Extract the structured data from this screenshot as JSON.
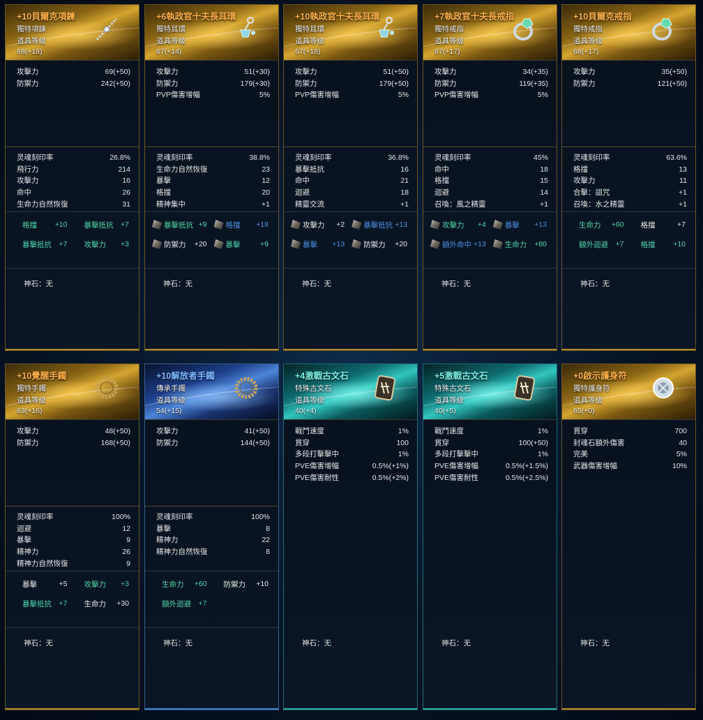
{
  "cards": [
    {
      "theme": "gold",
      "title": "+10貝爾克項鍊",
      "type": "獨特項鍊",
      "level_label": "道具等级",
      "level": "68(+18)",
      "icon": "necklace-icon",
      "main": [
        [
          "攻擊力",
          "69(+50)"
        ],
        [
          "防禦力",
          "242(+50)"
        ]
      ],
      "soul": [
        [
          "灵魂刻印率",
          "26.8%"
        ],
        [
          "飛行力",
          "214"
        ],
        [
          "攻擊力",
          "16"
        ],
        [
          "命中",
          "26"
        ],
        [
          "生命力自然恢復",
          "31"
        ]
      ],
      "bonus": [
        {
          "label": "格擋",
          "value": "+10",
          "color": "green",
          "icon": false
        },
        {
          "label": "暴擊抵抗",
          "value": "+7",
          "color": "green",
          "icon": false
        },
        {
          "label": "暴擊抵抗",
          "value": "+7",
          "color": "green",
          "icon": false
        },
        {
          "label": "攻擊力",
          "value": "+3",
          "color": "green",
          "icon": false
        }
      ],
      "godstone": "神石：无"
    },
    {
      "theme": "gold",
      "title": "+6執政官十夫長耳環",
      "type": "獨特耳環",
      "level_label": "道具等级",
      "level": "67(+14)",
      "icon": "earring-icon",
      "main": [
        [
          "攻擊力",
          "51(+30)"
        ],
        [
          "防禦力",
          "179(+30)"
        ],
        [
          "PVP傷害增幅",
          "5%"
        ]
      ],
      "soul": [
        [
          "灵魂刻印率",
          "38.8%"
        ],
        [
          "生命力自然恢復",
          "23"
        ],
        [
          "暴擊",
          "12"
        ],
        [
          "格擋",
          "20"
        ],
        [
          "精神集中",
          "+1"
        ]
      ],
      "bonus": [
        {
          "label": "暴擊抵抗",
          "value": "+9",
          "color": "green",
          "icon": true
        },
        {
          "label": "格擋",
          "value": "+18",
          "color": "blue",
          "icon": true
        },
        {
          "label": "防禦力",
          "value": "+20",
          "color": "white",
          "icon": true
        },
        {
          "label": "暴擊",
          "value": "+9",
          "color": "green",
          "icon": true
        }
      ],
      "godstone": "神石：无"
    },
    {
      "theme": "gold",
      "title": "+10執政官十夫長耳環",
      "type": "獨特耳環",
      "level_label": "道具等级",
      "level": "67(+18)",
      "icon": "earring-icon",
      "main": [
        [
          "攻擊力",
          "51(+50)"
        ],
        [
          "防禦力",
          "179(+50)"
        ],
        [
          "PVP傷害增幅",
          "5%"
        ]
      ],
      "soul": [
        [
          "灵魂刻印率",
          "36.8%"
        ],
        [
          "暴擊抵抗",
          "16"
        ],
        [
          "命中",
          "21"
        ],
        [
          "迴避",
          "18"
        ],
        [
          "精靈交流",
          "+1"
        ]
      ],
      "bonus": [
        {
          "label": "攻擊力",
          "value": "+2",
          "color": "white",
          "icon": true
        },
        {
          "label": "暴擊抵抗",
          "value": "+13",
          "color": "blue",
          "icon": true
        },
        {
          "label": "暴擊",
          "value": "+13",
          "color": "blue",
          "icon": true
        },
        {
          "label": "防禦力",
          "value": "+20",
          "color": "white",
          "icon": true
        }
      ],
      "godstone": "神石：无"
    },
    {
      "theme": "gold",
      "title": "+7執政官十夫長戒指",
      "type": "獨特戒指",
      "level_label": "道具等级",
      "level": "67(+17)",
      "icon": "ring-icon",
      "main": [
        [
          "攻擊力",
          "34(+35)"
        ],
        [
          "防禦力",
          "119(+35)"
        ],
        [
          "PVP傷害增幅",
          "5%"
        ]
      ],
      "soul": [
        [
          "灵魂刻印率",
          "45%"
        ],
        [
          "命中",
          "18"
        ],
        [
          "格擋",
          "15"
        ],
        [
          "迴避",
          "14"
        ],
        [
          "召喚：風之精靈",
          "+1"
        ]
      ],
      "bonus": [
        {
          "label": "攻擊力",
          "value": "+4",
          "color": "green",
          "icon": true
        },
        {
          "label": "暴擊",
          "value": "+13",
          "color": "blue",
          "icon": true
        },
        {
          "label": "額外命中",
          "value": "+13",
          "color": "blue",
          "icon": true
        },
        {
          "label": "生命力",
          "value": "+80",
          "color": "green",
          "icon": true
        }
      ],
      "godstone": "神石：无"
    },
    {
      "theme": "gold",
      "title": "+10貝爾克戒指",
      "type": "獨特戒指",
      "level_label": "道具等级",
      "level": "68(+17)",
      "icon": "ring-icon",
      "main": [
        [
          "攻擊力",
          "35(+50)"
        ],
        [
          "防禦力",
          "121(+50)"
        ]
      ],
      "soul": [
        [
          "灵魂刻印率",
          "63.6%"
        ],
        [
          "格擋",
          "13"
        ],
        [
          "攻擊力",
          "11"
        ],
        [
          "合擊：詛咒",
          "+1"
        ],
        [
          "召喚：水之精靈",
          "+1"
        ]
      ],
      "bonus": [
        {
          "label": "生命力",
          "value": "+60",
          "color": "green",
          "icon": false
        },
        {
          "label": "格擋",
          "value": "+7",
          "color": "white",
          "icon": false
        },
        {
          "label": "額外迴避",
          "value": "+7",
          "color": "green",
          "icon": false
        },
        {
          "label": "格擋",
          "value": "+10",
          "color": "green",
          "icon": false
        }
      ],
      "godstone": "神石：无"
    },
    {
      "theme": "gold",
      "title": "+10覺醒手鐲",
      "type": "獨特手鐲",
      "level_label": "道具等级",
      "level": "63(+16)",
      "icon": "bracelet-icon",
      "main": [
        [
          "攻擊力",
          "48(+50)"
        ],
        [
          "防禦力",
          "168(+50)"
        ]
      ],
      "soul": [
        [
          "灵魂刻印率",
          "100%"
        ],
        [
          "迴避",
          "12"
        ],
        [
          "暴擊",
          "9"
        ],
        [
          "精神力",
          "26"
        ],
        [
          "精神力自然恢復",
          "9"
        ]
      ],
      "bonus": [
        {
          "label": "暴擊",
          "value": "+5",
          "color": "white",
          "icon": false
        },
        {
          "label": "攻擊力",
          "value": "+3",
          "color": "green",
          "icon": false
        },
        {
          "label": "暴擊抵抗",
          "value": "+7",
          "color": "green",
          "icon": false
        },
        {
          "label": "生命力",
          "value": "+30",
          "color": "white",
          "icon": false
        }
      ],
      "godstone": "神石：无"
    },
    {
      "theme": "blue",
      "title": "+10解放者手鐲",
      "type": "傳承手鐲",
      "level_label": "道具等级",
      "level": "54(+15)",
      "icon": "bracelet-icon",
      "main": [
        [
          "攻擊力",
          "41(+50)"
        ],
        [
          "防禦力",
          "144(+50)"
        ]
      ],
      "soul": [
        [
          "灵魂刻印率",
          "100%"
        ],
        [
          "暴擊",
          "8"
        ],
        [
          "精神力",
          "22"
        ],
        [
          "精神力自然恢復",
          "8"
        ]
      ],
      "bonus": [
        {
          "label": "生命力",
          "value": "+60",
          "color": "green",
          "icon": false
        },
        {
          "label": "防禦力",
          "value": "+10",
          "color": "white",
          "icon": false
        },
        {
          "label": "額外迴避",
          "value": "+7",
          "color": "green",
          "icon": false
        }
      ],
      "godstone": "神石：无"
    },
    {
      "theme": "cyan",
      "title": "+4激戰古文石",
      "type": "特殊古文石",
      "level_label": "道具等级",
      "level": "40(+4)",
      "icon": "rune-stone-icon",
      "main": [
        [
          "戰鬥速度",
          "1%"
        ],
        [
          "貫穿",
          "100"
        ],
        [
          "多段打擊擊中",
          "1%"
        ],
        [
          "PVE傷害增幅",
          "0.5%(+1%)"
        ],
        [
          "PVE傷害耐性",
          "0.5%(+2%)"
        ]
      ],
      "soul": [],
      "bonus": [],
      "godstone": "神石：无"
    },
    {
      "theme": "cyan",
      "title": "+5激戰古文石",
      "type": "特殊古文石",
      "level_label": "道具等级",
      "level": "40(+5)",
      "icon": "rune-stone-icon",
      "main": [
        [
          "戰鬥速度",
          "1%"
        ],
        [
          "貫穿",
          "100(+50)"
        ],
        [
          "多段打擊擊中",
          "1%"
        ],
        [
          "PVE傷害增幅",
          "0.5%(+1.5%)"
        ],
        [
          "PVE傷害耐性",
          "0.5%(+2.5%)"
        ]
      ],
      "soul": [],
      "bonus": [],
      "godstone": "神石：无"
    },
    {
      "theme": "gold",
      "title": "+0啟示護身符",
      "type": "獨特護身符",
      "level_label": "道具等级",
      "level": "65(+0)",
      "icon": "amulet-icon",
      "main": [
        [
          "貫穿",
          "700"
        ],
        [
          "封魂石額外傷害",
          "40"
        ],
        [
          "完美",
          "5%"
        ],
        [
          "武器傷害增幅",
          "10%"
        ]
      ],
      "soul": [],
      "bonus": [],
      "godstone": "神石：无"
    }
  ]
}
